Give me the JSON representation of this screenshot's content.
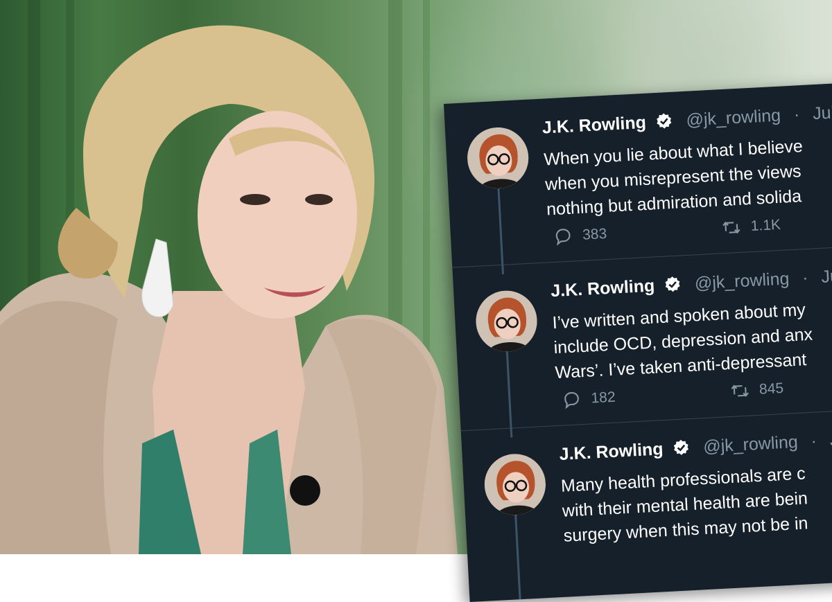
{
  "tweets": [
    {
      "name": "J.K. Rowling",
      "handle": "@jk_rowling",
      "date": "Jul",
      "lines": [
        "When you lie about what I believe",
        "when you misrepresent the views",
        "nothing but admiration and solida"
      ],
      "replies": "383",
      "retweets": "1.1K"
    },
    {
      "name": "J.K. Rowling",
      "handle": "@jk_rowling",
      "date": "Ju",
      "lines": [
        "I’ve written and spoken about my",
        "include OCD, depression and anx",
        "Wars’. I’ve taken anti-depressant"
      ],
      "replies": "182",
      "retweets": "845"
    },
    {
      "name": "J.K. Rowling",
      "handle": "@jk_rowling",
      "date": "J",
      "lines": [
        "Many health professionals are c",
        "with their mental health are bein",
        "surgery when this may not be in"
      ],
      "replies": "",
      "retweets": ""
    }
  ],
  "colors": {
    "card_bg": "#15202b",
    "text": "#ffffff",
    "muted": "#8899a6",
    "verified": "#ffffff"
  },
  "icons": [
    "verified-badge-icon",
    "reply-icon",
    "retweet-icon",
    "microphone-icon"
  ]
}
